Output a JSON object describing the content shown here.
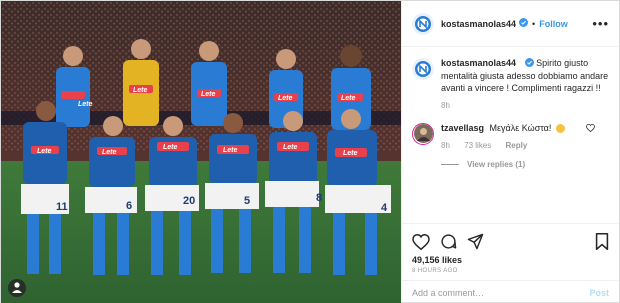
{
  "header": {
    "username": "kostasmanolas44",
    "separator": "•",
    "follow_label": "Follow",
    "more_label": "•••",
    "verified_icon": "verified-badge-icon"
  },
  "caption": {
    "username": "kostasmanolas44",
    "text": "Spirito giusto mentalità giusta adesso dobbiamo andare avanti a vincere ! Complimenti ragazzi !!",
    "time": "8h"
  },
  "comment": {
    "username": "tzavellasg",
    "text": "Μεγάλε Κώστα!",
    "emoji_icon": "flexed-biceps-emoji",
    "time": "8h",
    "likes": "73 likes",
    "reply_label": "Reply",
    "view_replies": "View replies (1)"
  },
  "actions": {
    "like_icon": "heart-icon",
    "comment_icon": "comment-icon",
    "share_icon": "share-icon",
    "save_icon": "bookmark-icon"
  },
  "likes": "49,156 likes",
  "timestamp": "8 HOURS AGO",
  "add_comment": {
    "placeholder": "Add a comment…",
    "post_label": "Post"
  },
  "photo": {
    "sponsor_text": "Lete",
    "shirt_numbers": [
      "11",
      "6",
      "20",
      "5",
      "8",
      "4"
    ]
  },
  "colors": {
    "accent": "#3897f0",
    "post_disabled": "#b2dffc",
    "muted": "#999999",
    "napoli_blue": "#2a7bd3"
  }
}
